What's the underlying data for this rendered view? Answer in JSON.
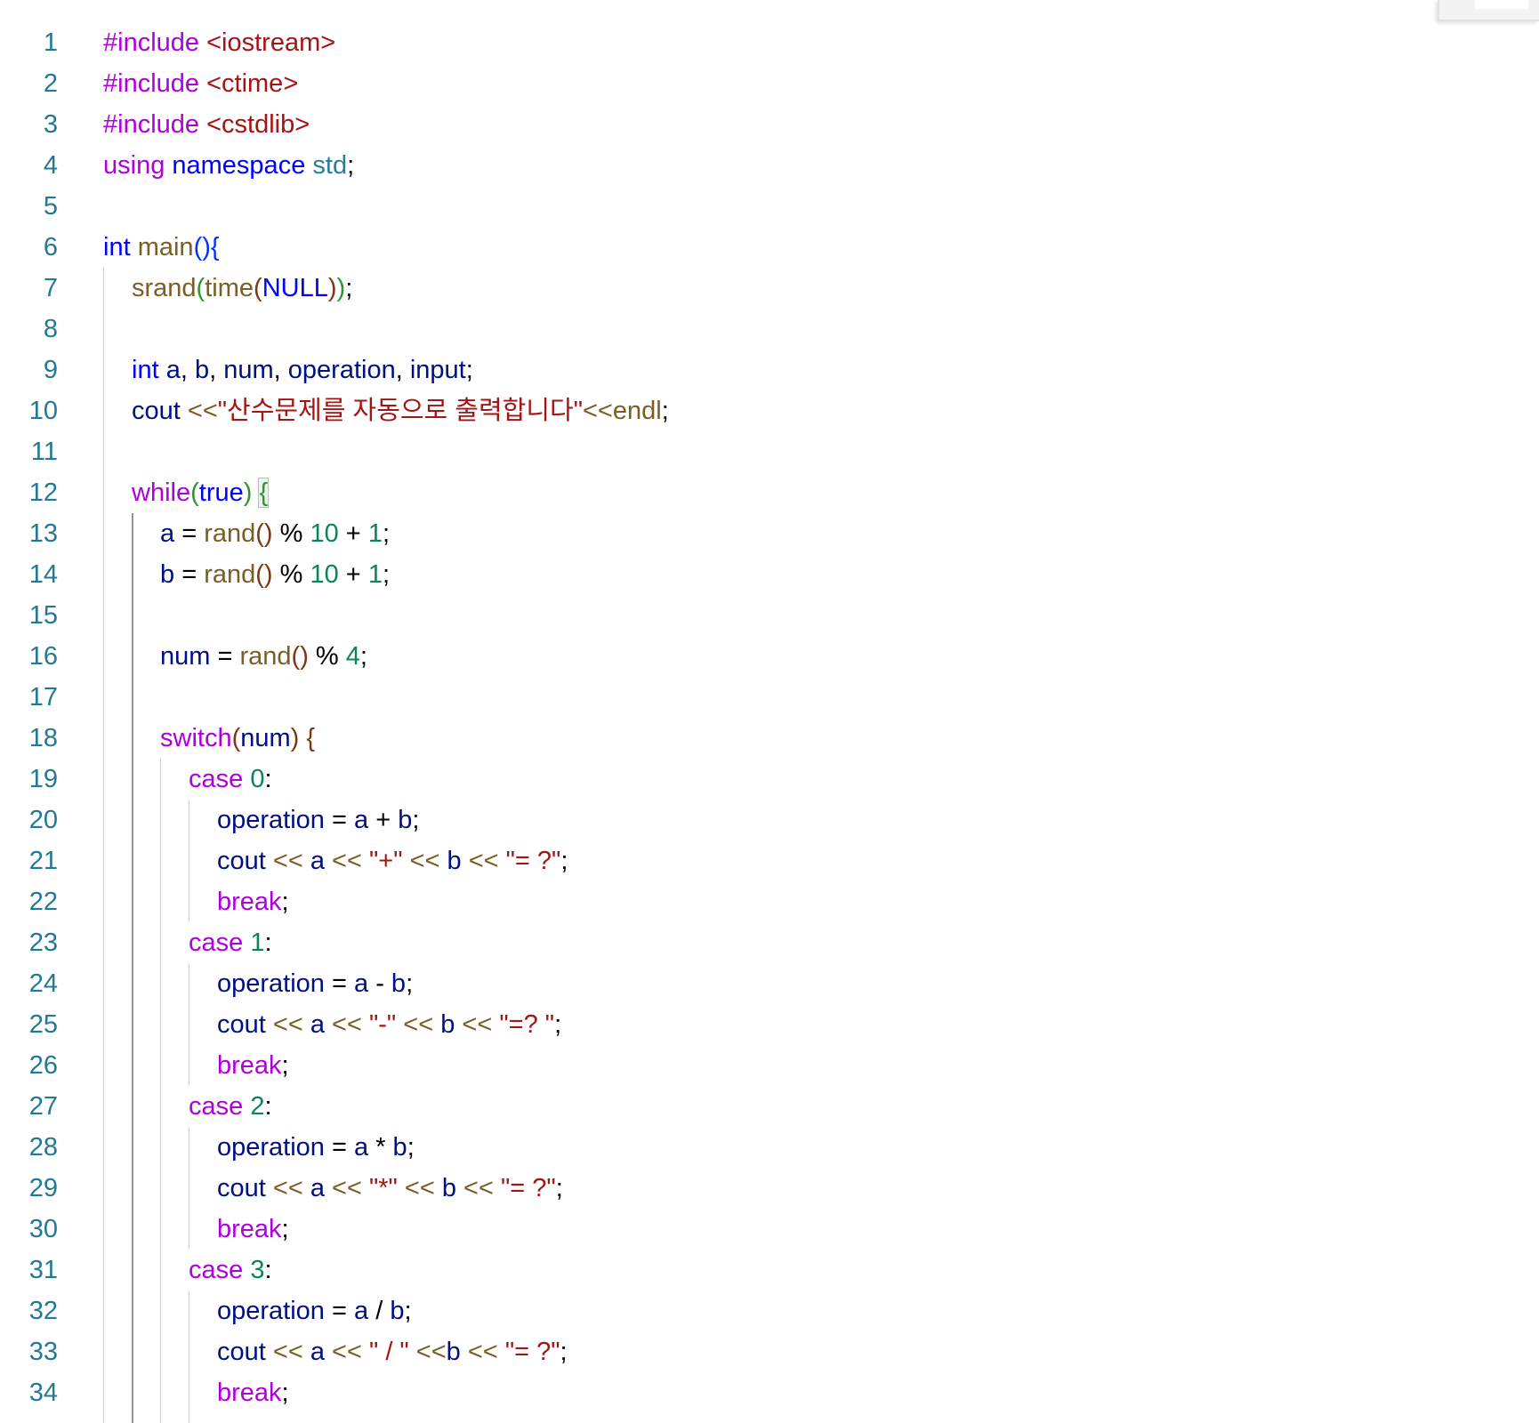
{
  "editor": {
    "language": "cpp",
    "lines": [
      {
        "n": "1",
        "indent": 0,
        "tokens": [
          [
            "t-kw-ctrl",
            "#include"
          ],
          [
            "t-punct",
            " "
          ],
          [
            "t-str",
            "<iostream>"
          ]
        ]
      },
      {
        "n": "2",
        "indent": 0,
        "tokens": [
          [
            "t-kw-ctrl",
            "#include"
          ],
          [
            "t-punct",
            " "
          ],
          [
            "t-str",
            "<ctime>"
          ]
        ]
      },
      {
        "n": "3",
        "indent": 0,
        "tokens": [
          [
            "t-kw-ctrl",
            "#include"
          ],
          [
            "t-punct",
            " "
          ],
          [
            "t-str",
            "<cstdlib>"
          ]
        ]
      },
      {
        "n": "4",
        "indent": 0,
        "tokens": [
          [
            "t-kw-ctrl",
            "using"
          ],
          [
            "t-punct",
            " "
          ],
          [
            "t-kw",
            "namespace"
          ],
          [
            "t-punct",
            " "
          ],
          [
            "t-ns",
            "std"
          ],
          [
            "t-punct",
            ";"
          ]
        ]
      },
      {
        "n": "5",
        "indent": 0,
        "tokens": []
      },
      {
        "n": "6",
        "indent": 0,
        "tokens": [
          [
            "t-type",
            "int"
          ],
          [
            "t-punct",
            " "
          ],
          [
            "t-fn",
            "main"
          ],
          [
            "t-b1",
            "()"
          ],
          [
            "t-b1",
            "{"
          ]
        ]
      },
      {
        "n": "7",
        "indent": 1,
        "tokens": [
          [
            "t-fn",
            "srand"
          ],
          [
            "t-b2",
            "("
          ],
          [
            "t-fn",
            "time"
          ],
          [
            "t-b3",
            "("
          ],
          [
            "t-macro",
            "NULL"
          ],
          [
            "t-b3",
            ")"
          ],
          [
            "t-b2",
            ")"
          ],
          [
            "t-punct",
            ";"
          ]
        ]
      },
      {
        "n": "8",
        "indent": 1,
        "tokens": []
      },
      {
        "n": "9",
        "indent": 1,
        "tokens": [
          [
            "t-type",
            "int"
          ],
          [
            "t-punct",
            " "
          ],
          [
            "t-var",
            "a"
          ],
          [
            "t-punct",
            ", "
          ],
          [
            "t-var",
            "b"
          ],
          [
            "t-punct",
            ", "
          ],
          [
            "t-var",
            "num"
          ],
          [
            "t-punct",
            ", "
          ],
          [
            "t-var",
            "operation"
          ],
          [
            "t-punct",
            ", "
          ],
          [
            "t-var",
            "input"
          ],
          [
            "t-punct",
            ";"
          ]
        ]
      },
      {
        "n": "10",
        "indent": 1,
        "tokens": [
          [
            "t-var",
            "cout"
          ],
          [
            "t-punct",
            " "
          ],
          [
            "t-ostream",
            "<<"
          ],
          [
            "t-str",
            "\"산수문제를 자동으로 출력합니다\""
          ],
          [
            "t-ostream",
            "<<"
          ],
          [
            "t-fn",
            "endl"
          ],
          [
            "t-punct",
            ";"
          ]
        ]
      },
      {
        "n": "11",
        "indent": 1,
        "tokens": []
      },
      {
        "n": "12",
        "indent": 1,
        "tokens": [
          [
            "t-kw-ctrl",
            "while"
          ],
          [
            "t-b2",
            "("
          ],
          [
            "t-kw",
            "true"
          ],
          [
            "t-b2",
            ")"
          ],
          [
            "t-punct",
            " "
          ],
          [
            "t-b2 bracket-box",
            "{"
          ]
        ]
      },
      {
        "n": "13",
        "indent": 2,
        "tokens": [
          [
            "t-var",
            "a"
          ],
          [
            "t-punct",
            " = "
          ],
          [
            "t-fn",
            "rand"
          ],
          [
            "t-b3",
            "()"
          ],
          [
            "t-punct",
            " % "
          ],
          [
            "t-num",
            "10"
          ],
          [
            "t-punct",
            " + "
          ],
          [
            "t-num",
            "1"
          ],
          [
            "t-punct",
            ";"
          ]
        ]
      },
      {
        "n": "14",
        "indent": 2,
        "tokens": [
          [
            "t-var",
            "b"
          ],
          [
            "t-punct",
            " = "
          ],
          [
            "t-fn",
            "rand"
          ],
          [
            "t-b3",
            "()"
          ],
          [
            "t-punct",
            " % "
          ],
          [
            "t-num",
            "10"
          ],
          [
            "t-punct",
            " + "
          ],
          [
            "t-num",
            "1"
          ],
          [
            "t-punct",
            ";"
          ]
        ]
      },
      {
        "n": "15",
        "indent": 2,
        "tokens": []
      },
      {
        "n": "16",
        "indent": 2,
        "tokens": [
          [
            "t-var",
            "num"
          ],
          [
            "t-punct",
            " = "
          ],
          [
            "t-fn",
            "rand"
          ],
          [
            "t-b3",
            "()"
          ],
          [
            "t-punct",
            " % "
          ],
          [
            "t-num",
            "4"
          ],
          [
            "t-punct",
            ";"
          ]
        ]
      },
      {
        "n": "17",
        "indent": 2,
        "tokens": []
      },
      {
        "n": "18",
        "indent": 2,
        "tokens": [
          [
            "t-kw-ctrl",
            "switch"
          ],
          [
            "t-b3",
            "("
          ],
          [
            "t-var",
            "num"
          ],
          [
            "t-b3",
            ")"
          ],
          [
            "t-punct",
            " "
          ],
          [
            "t-b3",
            "{"
          ]
        ]
      },
      {
        "n": "19",
        "indent": 3,
        "tokens": [
          [
            "t-kw-ctrl",
            "case"
          ],
          [
            "t-punct",
            " "
          ],
          [
            "t-num",
            "0"
          ],
          [
            "t-punct",
            ":"
          ]
        ]
      },
      {
        "n": "20",
        "indent": 4,
        "tokens": [
          [
            "t-var",
            "operation"
          ],
          [
            "t-punct",
            " = "
          ],
          [
            "t-var",
            "a"
          ],
          [
            "t-punct",
            " + "
          ],
          [
            "t-var",
            "b"
          ],
          [
            "t-punct",
            ";"
          ]
        ]
      },
      {
        "n": "21",
        "indent": 4,
        "tokens": [
          [
            "t-var",
            "cout"
          ],
          [
            "t-punct",
            " "
          ],
          [
            "t-ostream",
            "<<"
          ],
          [
            "t-punct",
            " "
          ],
          [
            "t-var",
            "a"
          ],
          [
            "t-punct",
            " "
          ],
          [
            "t-ostream",
            "<<"
          ],
          [
            "t-punct",
            " "
          ],
          [
            "t-str",
            "\"+\""
          ],
          [
            "t-punct",
            " "
          ],
          [
            "t-ostream",
            "<<"
          ],
          [
            "t-punct",
            " "
          ],
          [
            "t-var",
            "b"
          ],
          [
            "t-punct",
            " "
          ],
          [
            "t-ostream",
            "<<"
          ],
          [
            "t-punct",
            " "
          ],
          [
            "t-str",
            "\"= ?\""
          ],
          [
            "t-punct",
            ";"
          ]
        ]
      },
      {
        "n": "22",
        "indent": 4,
        "tokens": [
          [
            "t-kw-ctrl",
            "break"
          ],
          [
            "t-punct",
            ";"
          ]
        ]
      },
      {
        "n": "23",
        "indent": 3,
        "tokens": [
          [
            "t-kw-ctrl",
            "case"
          ],
          [
            "t-punct",
            " "
          ],
          [
            "t-num",
            "1"
          ],
          [
            "t-punct",
            ":"
          ]
        ]
      },
      {
        "n": "24",
        "indent": 4,
        "tokens": [
          [
            "t-var",
            "operation"
          ],
          [
            "t-punct",
            " = "
          ],
          [
            "t-var",
            "a"
          ],
          [
            "t-punct",
            " - "
          ],
          [
            "t-var",
            "b"
          ],
          [
            "t-punct",
            ";"
          ]
        ]
      },
      {
        "n": "25",
        "indent": 4,
        "tokens": [
          [
            "t-var",
            "cout"
          ],
          [
            "t-punct",
            " "
          ],
          [
            "t-ostream",
            "<<"
          ],
          [
            "t-punct",
            " "
          ],
          [
            "t-var",
            "a"
          ],
          [
            "t-punct",
            " "
          ],
          [
            "t-ostream",
            "<<"
          ],
          [
            "t-punct",
            " "
          ],
          [
            "t-str",
            "\"-\""
          ],
          [
            "t-punct",
            " "
          ],
          [
            "t-ostream",
            "<<"
          ],
          [
            "t-punct",
            " "
          ],
          [
            "t-var",
            "b"
          ],
          [
            "t-punct",
            " "
          ],
          [
            "t-ostream",
            "<<"
          ],
          [
            "t-punct",
            " "
          ],
          [
            "t-str",
            "\"=? \""
          ],
          [
            "t-punct",
            ";"
          ]
        ]
      },
      {
        "n": "26",
        "indent": 4,
        "tokens": [
          [
            "t-kw-ctrl",
            "break"
          ],
          [
            "t-punct",
            ";"
          ]
        ]
      },
      {
        "n": "27",
        "indent": 3,
        "tokens": [
          [
            "t-kw-ctrl",
            "case"
          ],
          [
            "t-punct",
            " "
          ],
          [
            "t-num",
            "2"
          ],
          [
            "t-punct",
            ":"
          ]
        ]
      },
      {
        "n": "28",
        "indent": 4,
        "tokens": [
          [
            "t-var",
            "operation"
          ],
          [
            "t-punct",
            " = "
          ],
          [
            "t-var",
            "a"
          ],
          [
            "t-punct",
            " * "
          ],
          [
            "t-var",
            "b"
          ],
          [
            "t-punct",
            ";"
          ]
        ]
      },
      {
        "n": "29",
        "indent": 4,
        "tokens": [
          [
            "t-var",
            "cout"
          ],
          [
            "t-punct",
            " "
          ],
          [
            "t-ostream",
            "<<"
          ],
          [
            "t-punct",
            " "
          ],
          [
            "t-var",
            "a"
          ],
          [
            "t-punct",
            " "
          ],
          [
            "t-ostream",
            "<<"
          ],
          [
            "t-punct",
            " "
          ],
          [
            "t-str",
            "\"*\""
          ],
          [
            "t-punct",
            " "
          ],
          [
            "t-ostream",
            "<<"
          ],
          [
            "t-punct",
            " "
          ],
          [
            "t-var",
            "b"
          ],
          [
            "t-punct",
            " "
          ],
          [
            "t-ostream",
            "<<"
          ],
          [
            "t-punct",
            " "
          ],
          [
            "t-str",
            "\"= ?\""
          ],
          [
            "t-punct",
            ";"
          ]
        ]
      },
      {
        "n": "30",
        "indent": 4,
        "tokens": [
          [
            "t-kw-ctrl",
            "break"
          ],
          [
            "t-punct",
            ";"
          ]
        ]
      },
      {
        "n": "31",
        "indent": 3,
        "tokens": [
          [
            "t-kw-ctrl",
            "case"
          ],
          [
            "t-punct",
            " "
          ],
          [
            "t-num",
            "3"
          ],
          [
            "t-punct",
            ":"
          ]
        ]
      },
      {
        "n": "32",
        "indent": 4,
        "tokens": [
          [
            "t-var",
            "operation"
          ],
          [
            "t-punct",
            " = "
          ],
          [
            "t-var",
            "a"
          ],
          [
            "t-punct",
            " / "
          ],
          [
            "t-var",
            "b"
          ],
          [
            "t-punct",
            ";"
          ]
        ]
      },
      {
        "n": "33",
        "indent": 4,
        "tokens": [
          [
            "t-var",
            "cout"
          ],
          [
            "t-punct",
            " "
          ],
          [
            "t-ostream",
            "<<"
          ],
          [
            "t-punct",
            " "
          ],
          [
            "t-var",
            "a"
          ],
          [
            "t-punct",
            " "
          ],
          [
            "t-ostream",
            "<<"
          ],
          [
            "t-punct",
            " "
          ],
          [
            "t-str",
            "\" / \""
          ],
          [
            "t-punct",
            " "
          ],
          [
            "t-ostream",
            "<<"
          ],
          [
            "t-var",
            "b"
          ],
          [
            "t-punct",
            " "
          ],
          [
            "t-ostream",
            "<<"
          ],
          [
            "t-punct",
            " "
          ],
          [
            "t-str",
            "\"= ?\""
          ],
          [
            "t-punct",
            ";"
          ]
        ]
      },
      {
        "n": "34",
        "indent": 4,
        "tokens": [
          [
            "t-kw-ctrl",
            "break"
          ],
          [
            "t-punct",
            ";"
          ]
        ]
      }
    ]
  }
}
